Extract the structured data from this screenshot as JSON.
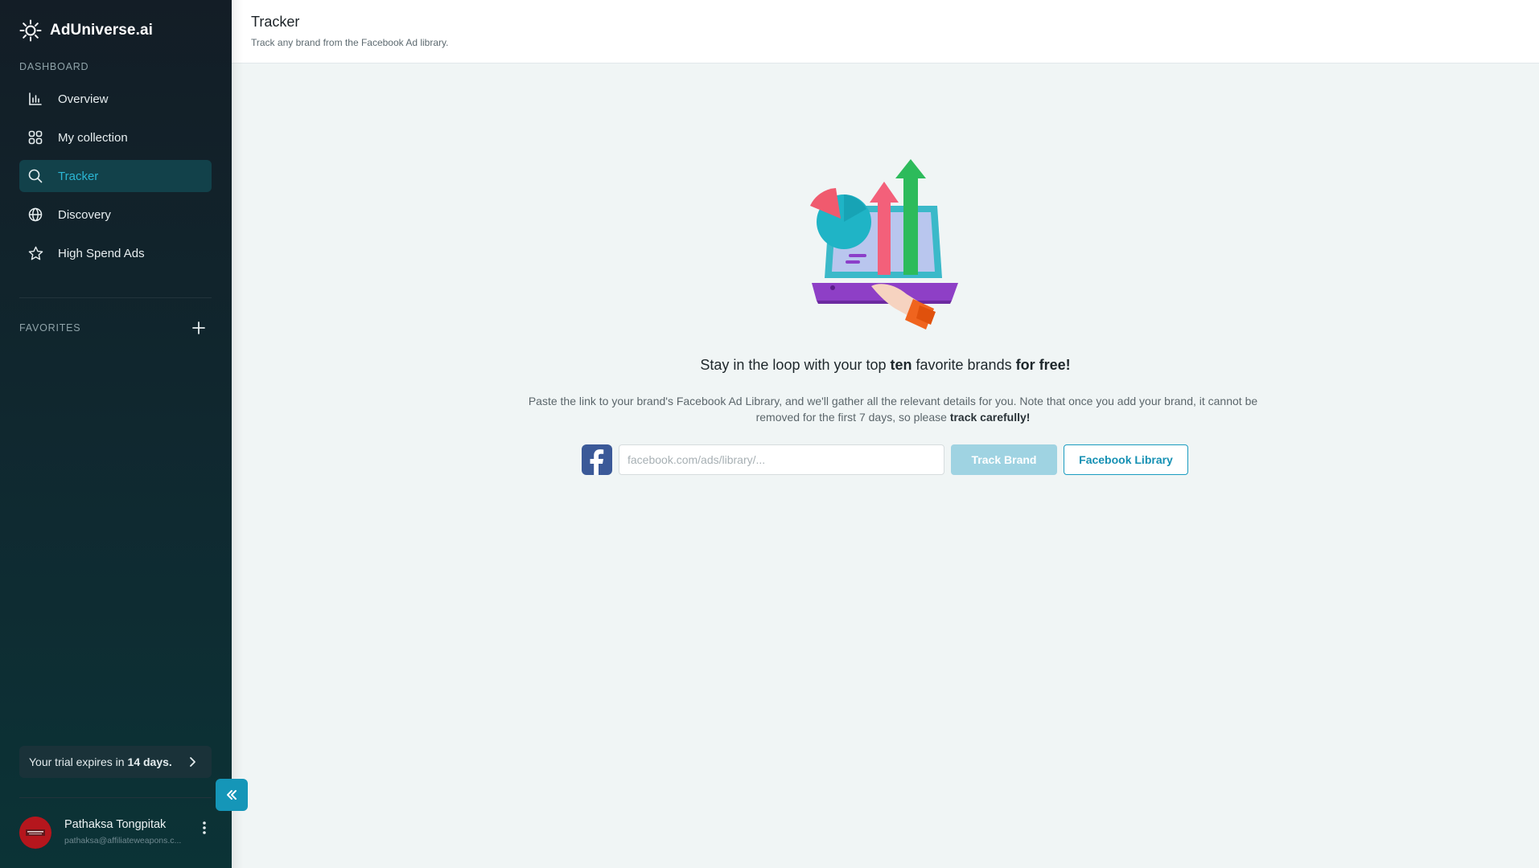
{
  "app": {
    "name": "AdUniverse.ai"
  },
  "sidebar": {
    "section_dashboard": "DASHBOARD",
    "items": [
      {
        "label": "Overview",
        "icon": "bar-chart-icon",
        "active": false
      },
      {
        "label": "My collection",
        "icon": "grid-icon",
        "active": false
      },
      {
        "label": "Tracker",
        "icon": "search-icon",
        "active": true
      },
      {
        "label": "Discovery",
        "icon": "globe-icon",
        "active": false
      },
      {
        "label": "High Spend Ads",
        "icon": "star-icon",
        "active": false
      }
    ],
    "section_favorites": "FAVORITES",
    "trial": {
      "prefix": "Your trial expires in",
      "days": "14 days."
    },
    "user": {
      "name": "Pathaksa Tongpitak",
      "email": "pathaksa@affiliateweapons.c..."
    }
  },
  "header": {
    "title": "Tracker",
    "subtitle": "Track any brand from the Facebook Ad library."
  },
  "main": {
    "headline": {
      "part1": "Stay in the loop with your top ",
      "bold1": "ten",
      "part2": " favorite brands ",
      "bold2": "for free!"
    },
    "description": {
      "text": "Paste the link to your brand's Facebook Ad Library, and we'll gather all the relevant details for you. Note that once you add your brand, it cannot be removed for the first 7 days, so please ",
      "bold": "track carefully!"
    },
    "input_placeholder": "facebook.com/ads/library/...",
    "track_button": "Track Brand",
    "library_button": "Facebook Library"
  },
  "colors": {
    "accent": "#1596b8",
    "active_nav_bg": "#12414a",
    "active_nav_text": "#2bb6d4",
    "facebook_blue": "#3b5998",
    "track_button_bg": "#9fd3e2"
  }
}
